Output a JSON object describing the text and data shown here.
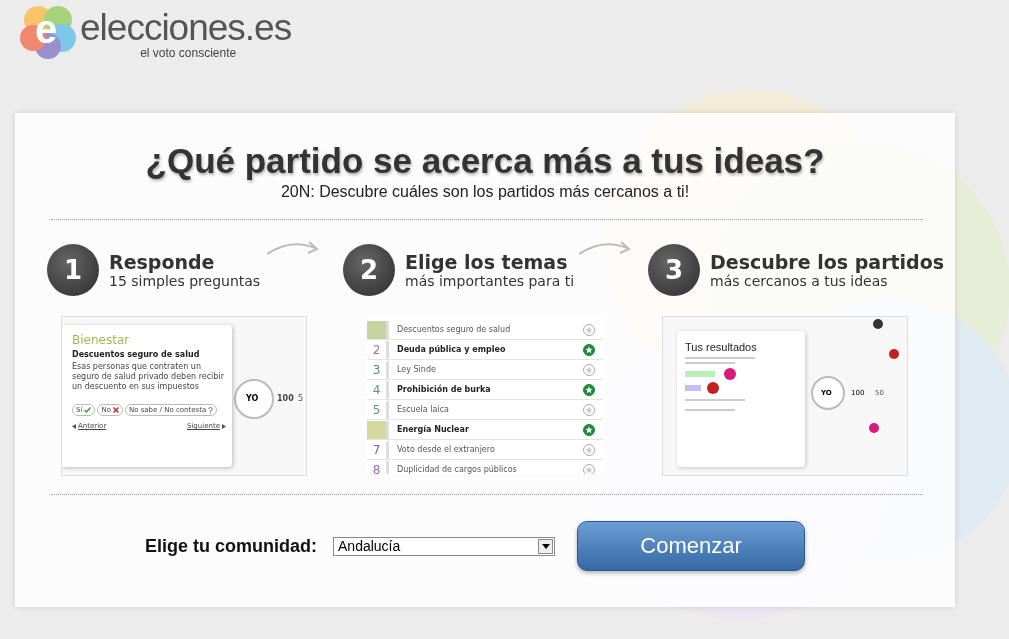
{
  "header": {
    "logo_letter": "e",
    "wordmark": "elecciones.es",
    "tagline": "el voto consciente"
  },
  "hero": {
    "title": "¿Qué partido se acerca más a tus ideas?",
    "subtitle": "20N: Descubre cuáles son los partidos más cercanos a ti!"
  },
  "steps": [
    {
      "number": "1",
      "title": "Responde",
      "subtitle": "15 simples preguntas"
    },
    {
      "number": "2",
      "title": "Elige los temas",
      "subtitle": "más importantes para ti"
    },
    {
      "number": "3",
      "title": "Descubre los partidos",
      "subtitle": "más cercanos a tus ideas"
    }
  ],
  "question_preview": {
    "category": "Bienestar",
    "question": "Descuentos seguro de salud",
    "text": "Esas personas que contraten un seguro de salud privado deben recibir un descuento en sus impuestos",
    "answers": [
      {
        "label": "Sí",
        "kind": "yes"
      },
      {
        "label": "No",
        "kind": "no"
      },
      {
        "label": "No sabe / No contesta",
        "kind": "unknown"
      }
    ],
    "previous": "Anterior",
    "next": "Siguiente",
    "dial": [
      "YO",
      "100",
      "5"
    ]
  },
  "topics_preview": {
    "topics": [
      {
        "color": "#c8d4a0",
        "label": "Descuentos seguro de salud",
        "selected": false
      },
      {
        "number": "2",
        "color": "#a36cb5",
        "label": "Deuda pública y empleo",
        "selected": true
      },
      {
        "number": "3",
        "color": "#4f8f7a",
        "label": "Ley Sinde",
        "selected": false
      },
      {
        "number": "4",
        "color": "#5a9a6a",
        "label": "Prohibición de burka",
        "selected": true
      },
      {
        "number": "5",
        "color": "#5a9a6a",
        "label": "Escuela laica",
        "selected": false
      },
      {
        "color": "#d4d8a0",
        "label": "Energía Nuclear",
        "selected": true
      },
      {
        "number": "7",
        "color": "#6a6a92",
        "label": "Voto desde el extranjero",
        "selected": false
      },
      {
        "number": "8",
        "color": "#a36cb5",
        "label": "Duplicidad de cargos públicos",
        "selected": false
      }
    ]
  },
  "results_preview": {
    "title": "Tus resultados",
    "dial": [
      "YO",
      "100",
      "50"
    ]
  },
  "form": {
    "label": "Elige tu comunidad:",
    "region": "Andalucía",
    "button": "Comenzar"
  }
}
